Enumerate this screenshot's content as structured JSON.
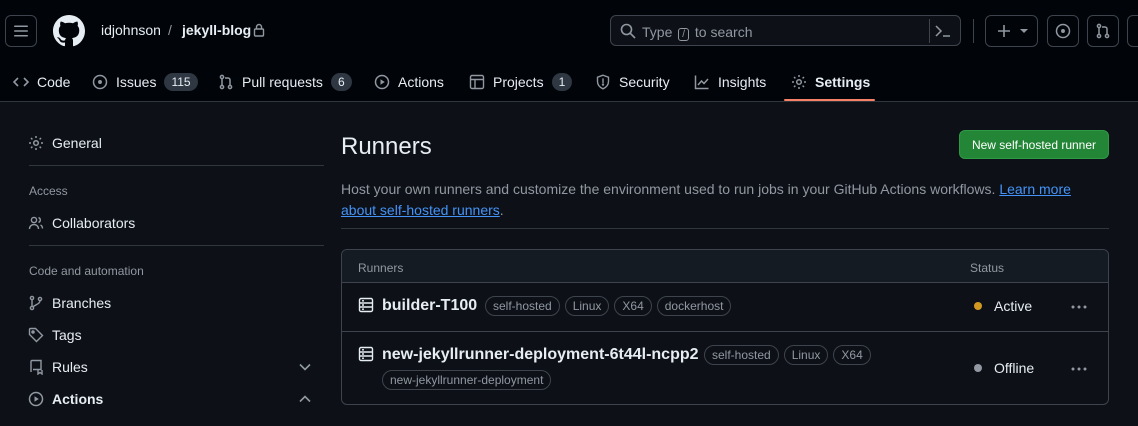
{
  "header": {
    "owner": "idjohnson",
    "separator": "/",
    "repo": "jekyll-blog",
    "search_prefix": "Type",
    "search_key": "/",
    "search_suffix": "to search"
  },
  "nav": {
    "code": "Code",
    "issues": "Issues",
    "issues_count": "115",
    "pulls": "Pull requests",
    "pulls_count": "6",
    "actions": "Actions",
    "projects": "Projects",
    "projects_count": "1",
    "security": "Security",
    "insights": "Insights",
    "settings": "Settings"
  },
  "sidebar": {
    "general": "General",
    "access_heading": "Access",
    "collaborators": "Collaborators",
    "code_heading": "Code and automation",
    "branches": "Branches",
    "tags": "Tags",
    "rules": "Rules",
    "actions": "Actions"
  },
  "main": {
    "title": "Runners",
    "new_button": "New self-hosted runner",
    "description": "Host your own runners and customize the environment used to run jobs in your GitHub Actions workflows.",
    "learn_more": "Learn more about self-hosted runners",
    "period": "."
  },
  "table": {
    "col_runners": "Runners",
    "col_status": "Status",
    "rows": [
      {
        "name": "builder-T100",
        "labels": [
          "self-hosted",
          "Linux",
          "X64",
          "dockerhost"
        ],
        "status": "Active",
        "status_color": "#d29922"
      },
      {
        "name": "new-jekyllrunner-deployment-6t44l-ncpp2",
        "labels": [
          "self-hosted",
          "Linux",
          "X64"
        ],
        "labels_line2": [
          "new-jekyllrunner-deployment"
        ],
        "status": "Offline",
        "status_color": "#9198a1"
      }
    ]
  },
  "colors": {
    "accent": "#f78166",
    "primary_button": "#238636",
    "link": "#4493f8",
    "background": "#0d1117"
  }
}
